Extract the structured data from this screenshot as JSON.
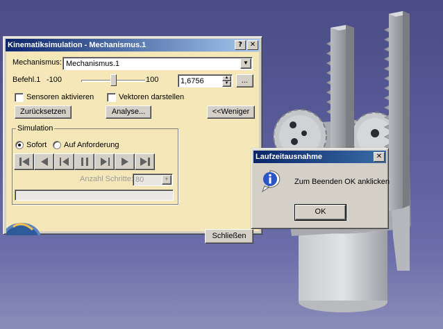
{
  "main_dialog": {
    "title": "Kinematiksimulation - Mechanismus.1",
    "help_label": "?",
    "close_label": "✕",
    "mechanism_label": "Mechanismus:",
    "mechanism_value": "Mechanismus.1",
    "command_label": "Befehl.1",
    "slider_min": "-100",
    "slider_max": "100",
    "slider_fraction": 0.508,
    "command_value": "1,6756",
    "more_button": "...",
    "sensors_label": "Sensoren aktivieren",
    "vectors_label": "Vektoren darstellen",
    "reset_button": "Zurücksetzen",
    "analysis_button": "Analyse...",
    "less_button": "<<Weniger",
    "simulation_group": "Simulation",
    "radio_immediate": "Sofort",
    "radio_on_demand": "Auf Anforderung",
    "steps_label": "Anzahl Schritte:",
    "steps_value": "80",
    "close_button": "Schließen"
  },
  "message_box": {
    "title": "Laufzeitausnahme",
    "close_label": "✕",
    "icon": "info-icon",
    "message": "Zum Beenden OK anklicken",
    "ok_button": "OK"
  },
  "colors": {
    "dialog_body": "#f5e7b8",
    "title_active": "#0a246a",
    "background": "#4a4c86"
  }
}
